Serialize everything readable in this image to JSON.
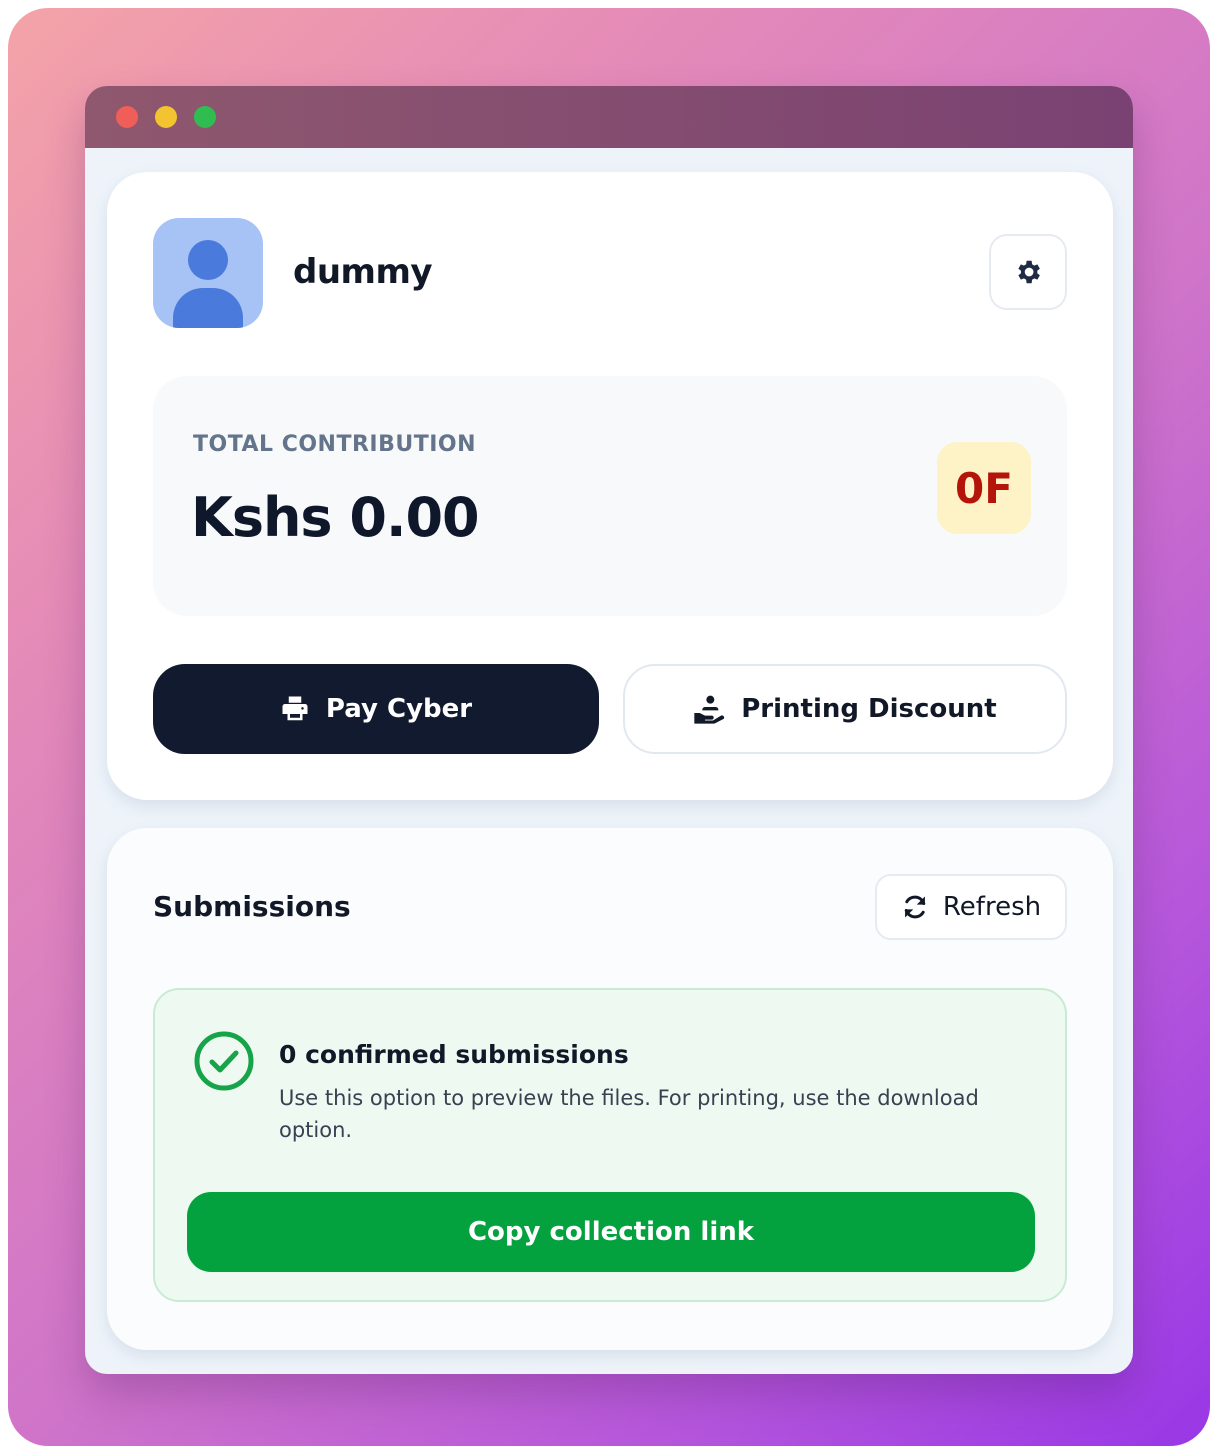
{
  "profile": {
    "username": "dummy"
  },
  "contribution": {
    "label": "TOTAL CONTRIBUTION",
    "amount": "Kshs 0.00",
    "badge": "0F"
  },
  "actions": {
    "pay_label": "Pay Cyber",
    "discount_label": "Printing Discount"
  },
  "submissions": {
    "title": "Submissions",
    "refresh_label": "Refresh",
    "status_title": "0 confirmed submissions",
    "status_desc": "Use this option to preview the files. For printing, use the download option.",
    "copy_label": "Copy collection link"
  },
  "icons": {
    "avatar": "user-avatar-icon",
    "settings": "gear-icon",
    "pay": "printer-icon",
    "discount": "hand-holding-user-icon",
    "refresh": "refresh-icon",
    "status": "check-circle-icon"
  },
  "colors": {
    "primary_dark": "#111a2e",
    "success": "#04a23e",
    "badge_bg": "#fdf3c7",
    "badge_text": "#b4140a",
    "avatar_bg": "#a7c3f5",
    "avatar_fg": "#4a7bdc"
  }
}
